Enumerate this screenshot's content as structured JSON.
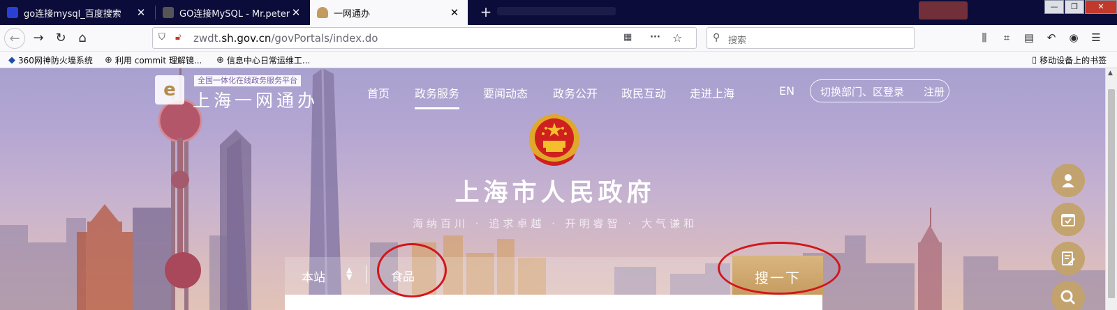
{
  "browser": {
    "tabs": [
      {
        "title": "go连接mysql_百度搜索",
        "favicon_color": "#2a3fd3"
      },
      {
        "title": "GO连接MySQL - Mr.peter - 博",
        "favicon_color": "#555555"
      },
      {
        "title": "一网通办",
        "favicon_color": "#c49a5f",
        "active": true
      }
    ],
    "window_controls": {
      "minimize": "—",
      "restore": "❐",
      "close": "✕"
    },
    "url": {
      "host_prefix": "zwdt.",
      "host_main": "sh.gov.cn",
      "path": "/govPortals/index.do"
    },
    "search_placeholder": "搜索",
    "bookmarks": [
      "360网神防火墙系统",
      "利用 commit 理解镜...",
      "信息中心日常运维工..."
    ],
    "mobile_bookmarks": "移动设备上的书签"
  },
  "site": {
    "logo_tagline": "全国一体化在线政务服务平台",
    "logo_name": "上海一网通办",
    "menu": [
      "首页",
      "政务服务",
      "要闻动态",
      "政务公开",
      "政民互动",
      "走进上海"
    ],
    "active_menu_index": 1,
    "lang": "EN",
    "switch_label": "切换部门、区登录",
    "login_label": "登录",
    "register_label": "注册",
    "hero_title": "上海市人民政府",
    "hero_slogan": "海纳百川 · 追求卓越 · 开明睿智 · 大气谦和",
    "search": {
      "scope": "本站",
      "query": "食品",
      "button": "搜一下"
    },
    "colors": {
      "accent_gold": "#c49a5f",
      "annotation_red": "#d3151b"
    },
    "side_tools": [
      "user-icon",
      "calendar-check-icon",
      "edit-note-icon",
      "search-icon"
    ]
  }
}
